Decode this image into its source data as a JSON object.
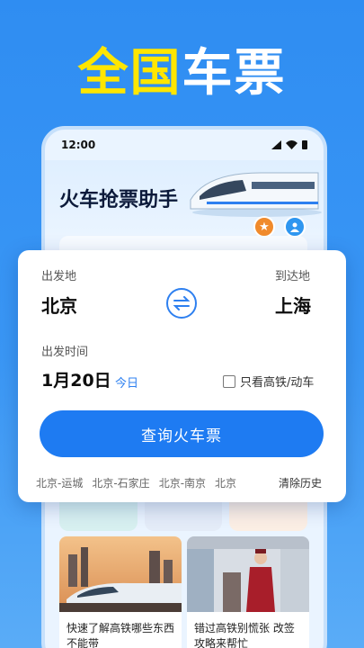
{
  "headline": {
    "part1": "全国",
    "part2": "车票"
  },
  "status": {
    "time": "12:00"
  },
  "app": {
    "title": "火车抢票助手"
  },
  "search": {
    "from_label": "出发地",
    "to_label": "到达地",
    "from_city": "北京",
    "to_city": "上海",
    "time_label": "出发时间",
    "date": "1月20日",
    "today": "今日",
    "checkbox_label": "只看高铁/动车",
    "search_button": "查询火车票"
  },
  "history": {
    "items": [
      "北京-运城",
      "北京-石家庄",
      "北京-南京",
      "北京"
    ],
    "clear": "清除历史"
  },
  "news": [
    {
      "title": "快速了解高铁哪些东西不能带"
    },
    {
      "title": "错过高铁别慌张 改签攻略来帮忙"
    }
  ],
  "colors": {
    "accent": "#1e7bf2",
    "headline_yellow": "#ffe600",
    "star": "#f08a2c"
  }
}
